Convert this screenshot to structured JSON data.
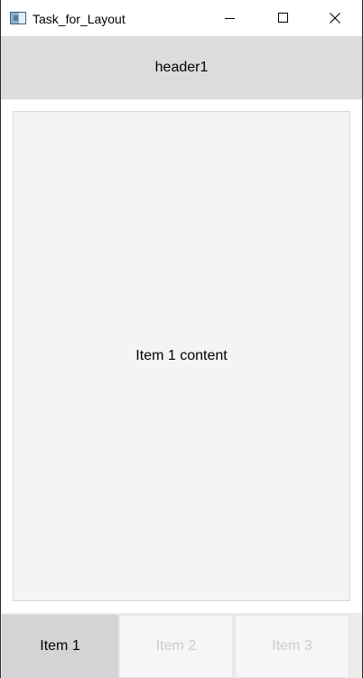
{
  "window": {
    "title": "Task_for_Layout"
  },
  "header": {
    "text": "header1"
  },
  "content": {
    "text": "Item 1 content"
  },
  "tabs": [
    {
      "label": "Item 1",
      "selected": true
    },
    {
      "label": "Item 2",
      "selected": false
    },
    {
      "label": "Item 3",
      "selected": false
    }
  ],
  "icons": {
    "app": "app-icon",
    "minimize": "minimize-icon",
    "maximize": "maximize-icon",
    "close": "close-icon"
  },
  "colors": {
    "header_bg": "#dcdcdc",
    "content_bg": "#f4f4f4",
    "selected_tab_bg": "#d4d4d4",
    "disabled_text": "#cccccc"
  }
}
